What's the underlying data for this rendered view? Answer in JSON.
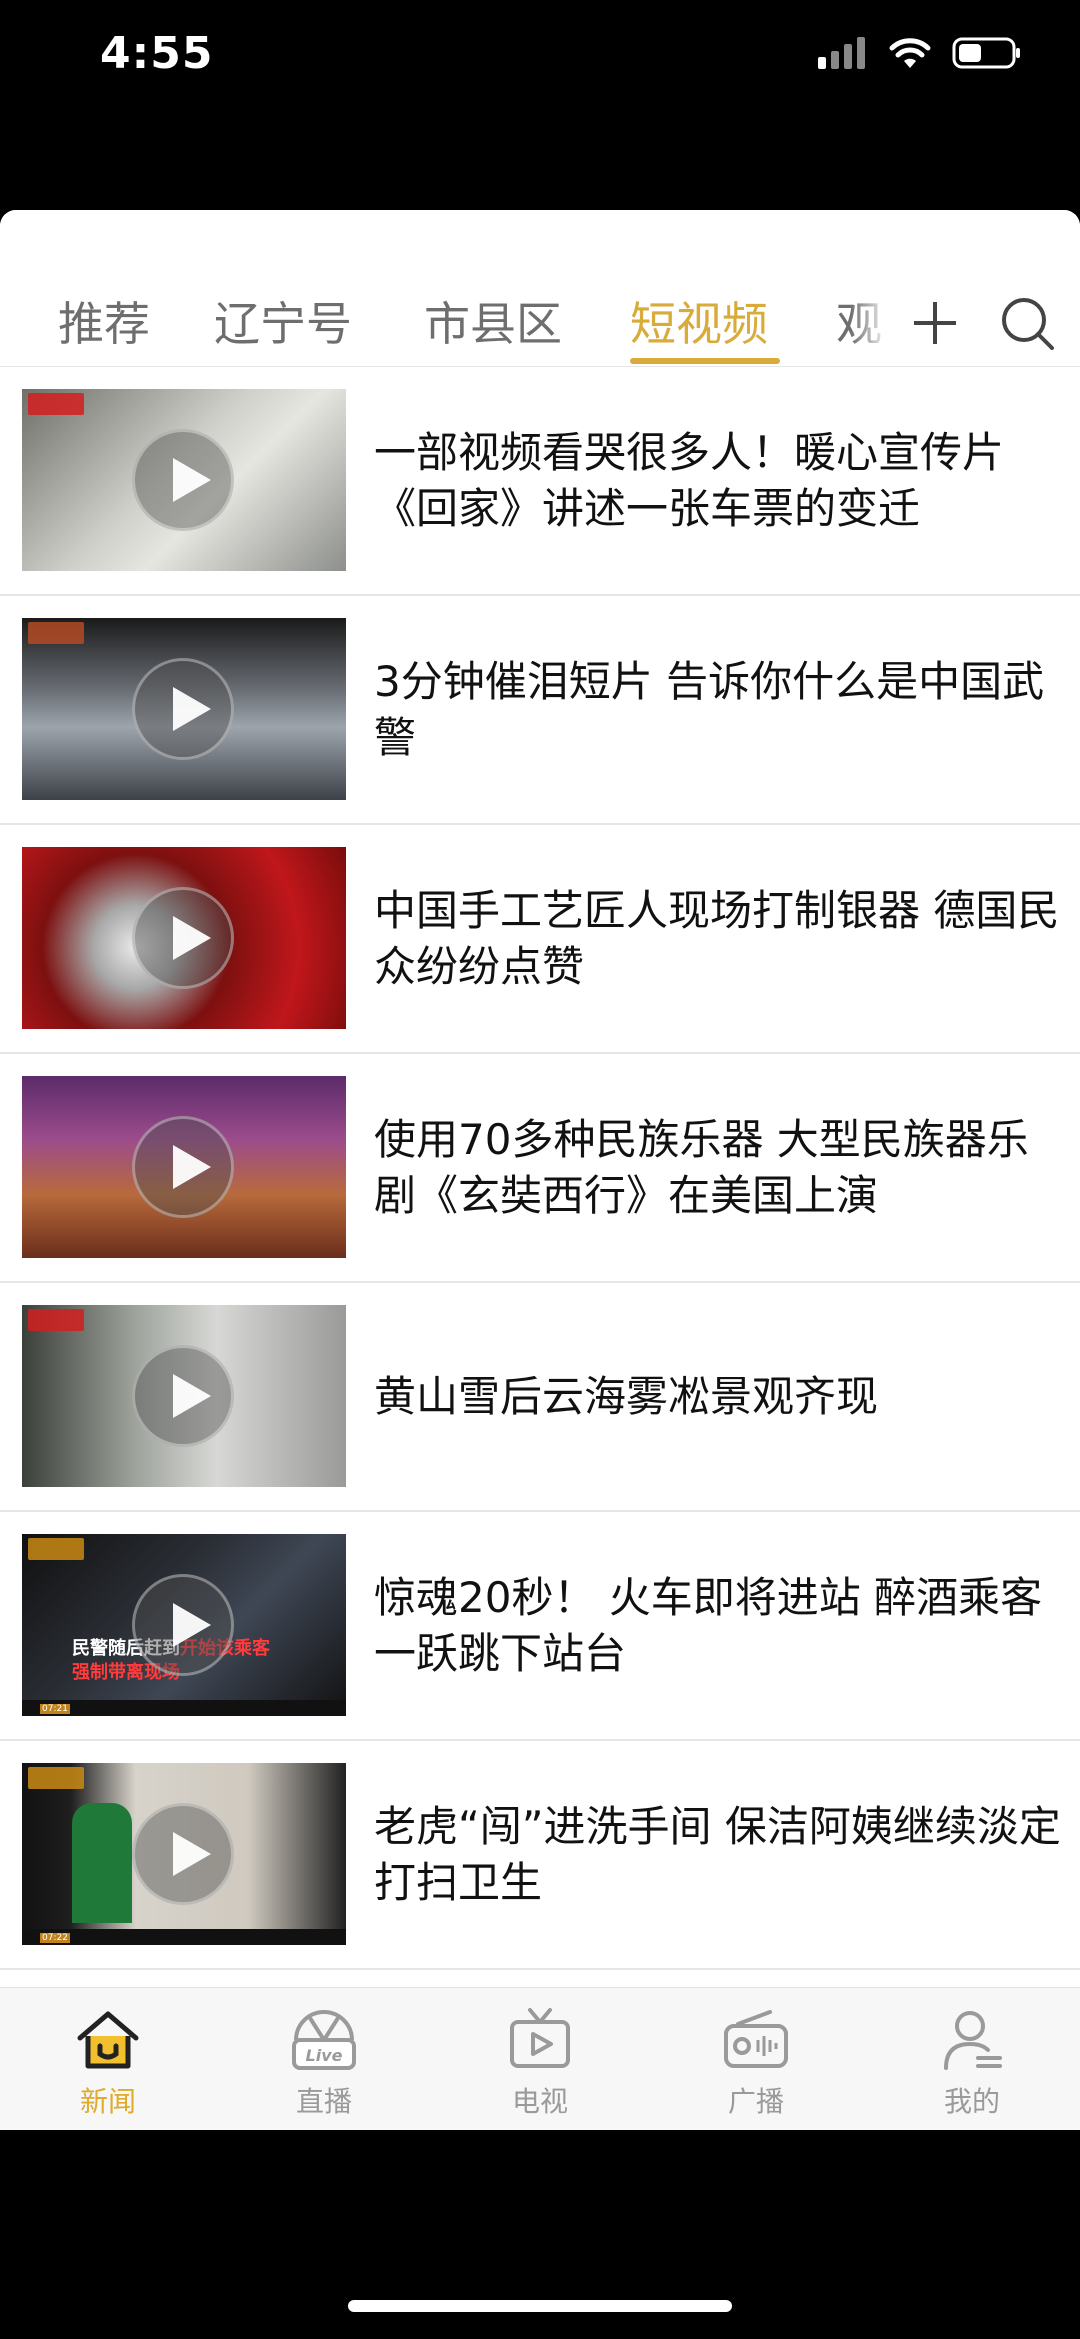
{
  "status": {
    "time": "4:55"
  },
  "tabs": {
    "items": [
      {
        "label": "推荐"
      },
      {
        "label": "辽宁号"
      },
      {
        "label": "市县区"
      },
      {
        "label": "短视频",
        "active": true
      },
      {
        "label": "观"
      }
    ],
    "accent_color": "#d9ab3a"
  },
  "videos": [
    {
      "title": "一部视频看哭很多人！暖心宣传片《回家》讲述一张车票的变迁"
    },
    {
      "title": "3分钟催泪短片 告诉你什么是中国武警"
    },
    {
      "title": "中国手工艺匠人现场打制银器 德国民众纷纷点赞"
    },
    {
      "title": "使用70多种民族乐器 大型民族器乐剧《玄奘西行》在美国上演"
    },
    {
      "title": "黄山雪后云海雾凇景观齐现"
    },
    {
      "title": "惊魂20秒！ 火车即将进站 醉酒乘客一跃跳下站台"
    },
    {
      "title": "老虎“闯”进洗手间 保洁阿姨继续淡定打扫卫生"
    }
  ],
  "thumb_text": {
    "v6_caption_line1": "民警随后赶到",
    "v6_caption_line1_red": "开始该乘客",
    "v6_caption_line2": "强制带离现场",
    "v6_clock": "07:21",
    "v7_clock": "07:22"
  },
  "bottom_nav": {
    "items": [
      {
        "label": "新闻",
        "active": true
      },
      {
        "label": "直播"
      },
      {
        "label": "电视"
      },
      {
        "label": "广播"
      },
      {
        "label": "我的"
      }
    ],
    "active_color": "#e0aa2c"
  }
}
